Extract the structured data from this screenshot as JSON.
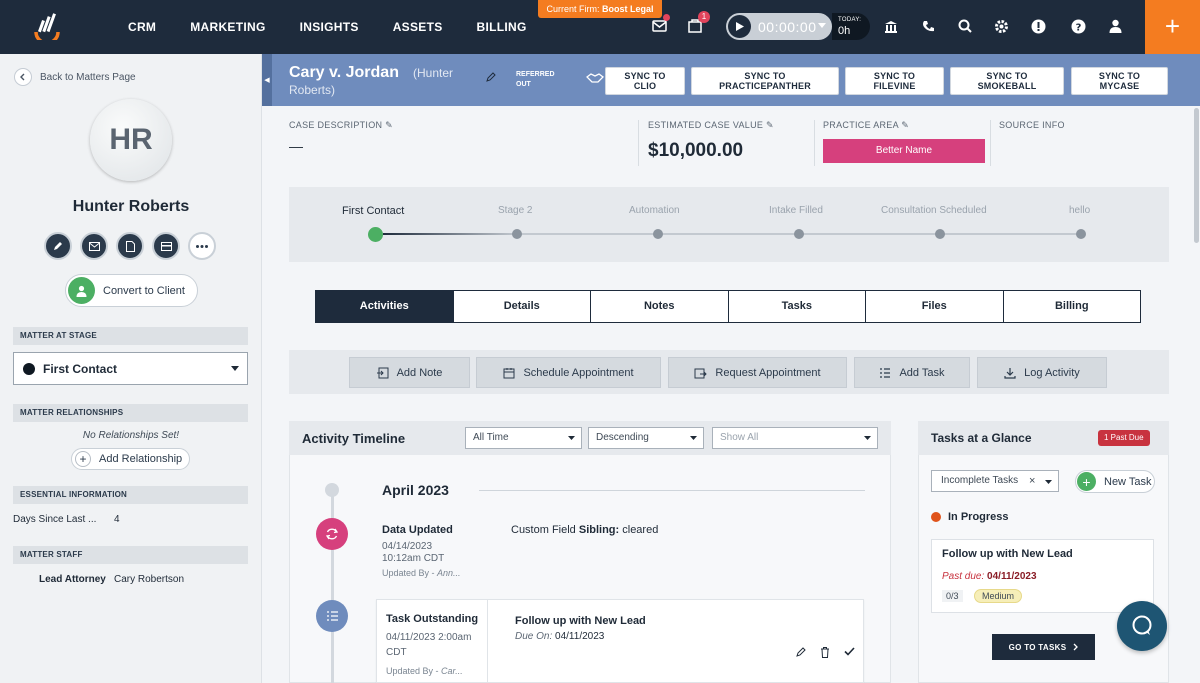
{
  "topbar": {
    "nav": [
      "CRM",
      "MARKETING",
      "INSIGHTS",
      "ASSETS",
      "BILLING"
    ],
    "firm_label": "Current Firm:",
    "firm_name": "Boost Legal",
    "inbox_badge": "1",
    "timer": "00:00:00",
    "today_label": "TODAY:",
    "today_value": "0h",
    "plus": "+"
  },
  "sidebar": {
    "back": "Back to Matters Page",
    "initials": "HR",
    "name": "Hunter Roberts",
    "convert": "Convert to Client",
    "stage_header": "MATTER AT STAGE",
    "stage_value": "First Contact",
    "relationships_header": "MATTER RELATIONSHIPS",
    "no_relationships": "No Relationships Set!",
    "add_relationship": "Add Relationship",
    "essential_header": "ESSENTIAL INFORMATION",
    "days_label": "Days Since Last ...",
    "days_value": "4",
    "staff_header": "MATTER STAFF",
    "lead_label": "Lead Attorney",
    "lead_value": "Cary Robertson"
  },
  "case": {
    "title": "Cary v. Jordan",
    "sub_a": "(Hunter",
    "sub_b": "Roberts)",
    "referred_a": "REFERRED",
    "referred_b": "OUT",
    "sync": [
      {
        "a": "SYNC TO",
        "b": "CLIO"
      },
      {
        "a": "SYNC TO",
        "b": "PRACTICEPANTHER"
      },
      {
        "a": "SYNC TO",
        "b": "FILEVINE"
      },
      {
        "a": "SYNC TO",
        "b": "SMOKEBALL"
      },
      {
        "a": "SYNC TO",
        "b": "MYCASE"
      }
    ],
    "desc_label": "CASE DESCRIPTION",
    "desc_value": "—",
    "value_label": "ESTIMATED CASE VALUE",
    "value": "$10,000.00",
    "practice_label": "PRACTICE AREA",
    "practice_value": "Better Name",
    "source_label": "SOURCE INFO"
  },
  "stages": [
    "First Contact",
    "Stage 2",
    "Automation",
    "Intake Filled",
    "Consultation Scheduled",
    "hello"
  ],
  "tabs": [
    "Activities",
    "Details",
    "Notes",
    "Tasks",
    "Files",
    "Billing"
  ],
  "actions": [
    "Add Note",
    "Schedule Appointment",
    "Request Appointment",
    "Add Task",
    "Log Activity"
  ],
  "timeline": {
    "title": "Activity Timeline",
    "filter_time": "All Time",
    "filter_order": "Descending",
    "filter_show": "Show All",
    "month": "April 2023",
    "event1": {
      "title": "Data Updated",
      "date": "04/14/2023",
      "time": "10:12am CDT",
      "by_label": "Updated By -",
      "by_value": "Ann...",
      "field_prefix": "Custom Field",
      "field_name": "Sibling:",
      "field_value": "cleared"
    },
    "event2": {
      "title": "Task Outstanding",
      "date": "04/11/2023 2:00am",
      "tz": "CDT",
      "by_label": "Updated By -",
      "by_value": "Car...",
      "task": "Follow up with New Lead",
      "due_label": "Due On:",
      "due_value": "04/11/2023"
    }
  },
  "glance": {
    "title": "Tasks at a Glance",
    "past_due": "1 Past Due",
    "filter": "Incomplete Tasks",
    "new_task": "New Task",
    "status": "In Progress",
    "card_title": "Follow up with New Lead",
    "past_due_label": "Past due:",
    "past_due_date": "04/11/2023",
    "progress": "0/3",
    "priority": "Medium",
    "go": "GO TO TASKS"
  }
}
